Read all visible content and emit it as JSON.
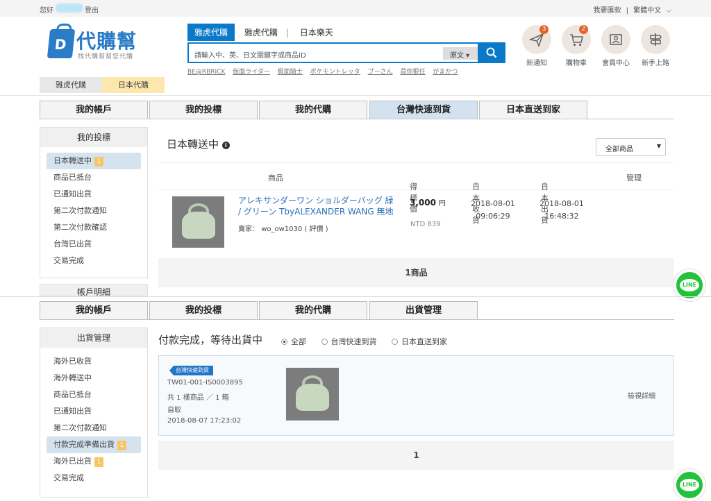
{
  "topbar": {
    "greeting": "您好",
    "logout": "登出",
    "links": [
      "我要匯款",
      "|",
      "繁體中文"
    ]
  },
  "logo": {
    "title": "代購幫",
    "subtitle": "找代購幫幫您代購",
    "letter": "D"
  },
  "site_tabs": [
    {
      "label": "雅虎代購",
      "active": true
    },
    {
      "label": "雅虎代購",
      "active": false
    },
    {
      "label": "日本樂天",
      "active": false
    }
  ],
  "search": {
    "placeholder": "請輸入中、英、日文關鍵字或商品ID",
    "lang": "原文"
  },
  "hot_keywords": [
    "BE@RBRICK",
    "仮面ライダー",
    "假面騎士",
    "ポケモントレッタ",
    "ブーさん",
    "蒜你狠任",
    "がまかつ"
  ],
  "header_icons": [
    {
      "label": "新通知",
      "badge": "3",
      "icon": "paper-plane-icon"
    },
    {
      "label": "購物車",
      "badge": "2",
      "icon": "cart-icon"
    },
    {
      "label": "會員中心",
      "badge": "",
      "icon": "member-card-icon"
    },
    {
      "label": "新手上路",
      "badge": "",
      "icon": "signpost-icon"
    }
  ],
  "sub_tabs": [
    {
      "label": "雅虎代購"
    },
    {
      "label": "日本代購"
    }
  ],
  "main_tabs_1": [
    "我的帳戶",
    "我的投標",
    "我的代購",
    "台灣快速到貨",
    "日本直送到家"
  ],
  "sidebar1": {
    "title": "我的投標",
    "items": [
      {
        "label": "日本轉送中",
        "count": "1"
      },
      {
        "label": "商品已抵台",
        "count": ""
      },
      {
        "label": "已通知出貨",
        "count": ""
      },
      {
        "label": "第二次付款通知",
        "count": ""
      },
      {
        "label": "第二次付款確認",
        "count": ""
      },
      {
        "label": "台灣已出貨",
        "count": ""
      },
      {
        "label": "交易完成",
        "count": ""
      }
    ],
    "next_title": "帳戶明細"
  },
  "section1": {
    "title": "日本轉送中",
    "filter": "全部商品",
    "columns": [
      "商品",
      "得標價",
      "日本收貨",
      "日本出貨",
      "管理"
    ],
    "product": {
      "name_line1": "アレキサンダーワン ショルダーバッグ 緑",
      "name_line2": "/ グリーン TbyALEXANDER WANG 無地",
      "seller_label": "賣家：",
      "seller": "wo_ow1030",
      "rating": "( 評價 )",
      "price": "3,000",
      "currency": "円",
      "ntd": "NTD 839",
      "recv_date": "2018-08-01",
      "recv_time": "09:06:29",
      "ship_date": "2018-08-01",
      "ship_time": "16:48:32"
    },
    "footer": "1商品"
  },
  "main_tabs_2": [
    "我的帳戶",
    "我的投標",
    "我的代購",
    "出貨管理"
  ],
  "sidebar2": {
    "title": "出貨管理",
    "items": [
      {
        "label": "海外已收貨",
        "count": ""
      },
      {
        "label": "海外轉送中",
        "count": ""
      },
      {
        "label": "商品已抵台",
        "count": ""
      },
      {
        "label": "已通知出貨",
        "count": ""
      },
      {
        "label": "第二次付款通知",
        "count": ""
      },
      {
        "label": "付款完成準備出貨",
        "count": "1"
      },
      {
        "label": "海外已出貨",
        "count": "1"
      },
      {
        "label": "交易完成",
        "count": ""
      }
    ]
  },
  "section2": {
    "title": "付款完成，等待出貨中",
    "radios": [
      {
        "label": "全部",
        "checked": true
      },
      {
        "label": "台灣快速到貨",
        "checked": false
      },
      {
        "label": "日本直送到家",
        "checked": false
      }
    ],
    "order": {
      "tag": "台灣快速到貨",
      "id": "TW01-001-IS0003895",
      "summary": "共 1 樣商品 ／ 1 箱",
      "method": "自取",
      "datetime": "2018-08-07 17:23:02",
      "detail_link": "檢視詳細"
    },
    "footer": "1"
  },
  "line": {
    "label": "LINE"
  }
}
